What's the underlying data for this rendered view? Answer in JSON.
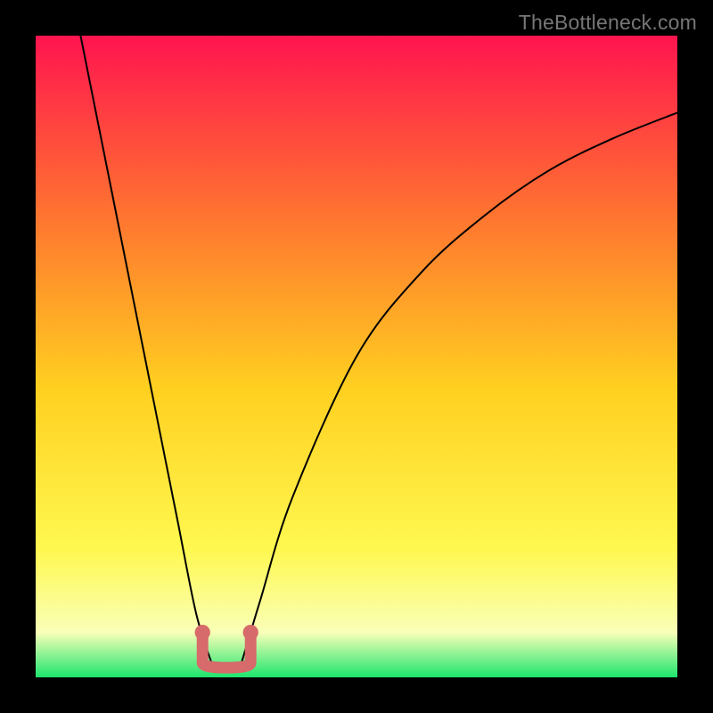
{
  "watermark": "TheBottleneck.com",
  "chart_data": {
    "type": "line",
    "title": "",
    "xlabel": "",
    "ylabel": "",
    "xlim": [
      0,
      100
    ],
    "ylim": [
      0,
      100
    ],
    "background_gradient": {
      "top": "#ff144f",
      "upper_mid": "#ff7430",
      "mid": "#ffd020",
      "lower_mid": "#fff850",
      "pale": "#f9ffb7",
      "bottom": "#1de56e"
    },
    "curve_left": {
      "description": "Steep descending left limb of bottleneck V-curve",
      "x": [
        7,
        12,
        17,
        22,
        25,
        27.5
      ],
      "y": [
        100,
        75,
        50,
        25,
        10,
        2
      ]
    },
    "curve_right": {
      "description": "Concave right limb rising from bottleneck minimum",
      "x": [
        32,
        35,
        40,
        50,
        60,
        70,
        80,
        90,
        100
      ],
      "y": [
        2,
        12,
        28,
        50,
        63,
        72,
        79,
        84,
        88
      ]
    },
    "valley_marker": {
      "description": "Salmon U-shaped marker around curve minimum",
      "color": "#d76a6a",
      "endpoint_radius": 1.2,
      "width": 1.8,
      "left_x": 26,
      "right_x": 33.5,
      "top_y": 7,
      "bottom_y": 1.5
    },
    "grid": false,
    "legend": false
  }
}
